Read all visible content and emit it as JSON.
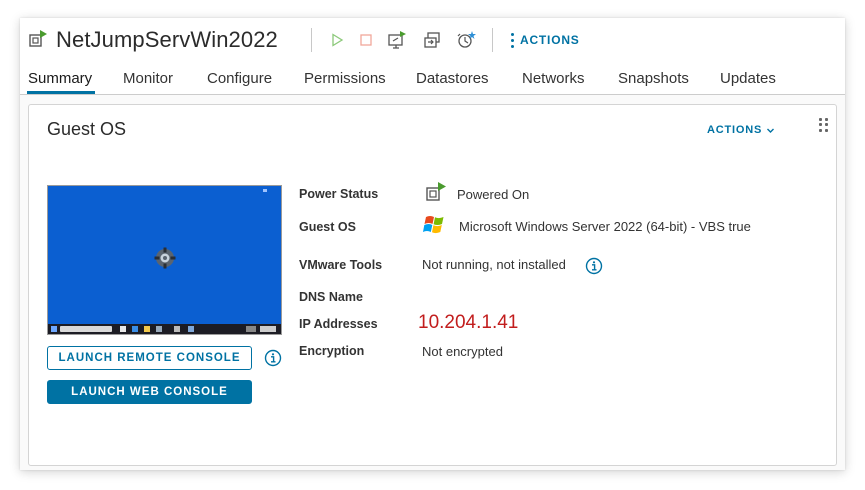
{
  "header": {
    "vm_name": "NetJumpServWin2022",
    "actions_label": "ACTIONS",
    "toolbar_icons": [
      "power-on-icon",
      "power-off-icon",
      "launch-console-icon",
      "migrate-icon",
      "snapshot-icon"
    ]
  },
  "tabs": [
    {
      "label": "Summary",
      "active": true
    },
    {
      "label": "Monitor",
      "active": false
    },
    {
      "label": "Configure",
      "active": false
    },
    {
      "label": "Permissions",
      "active": false
    },
    {
      "label": "Datastores",
      "active": false
    },
    {
      "label": "Networks",
      "active": false
    },
    {
      "label": "Snapshots",
      "active": false
    },
    {
      "label": "Updates",
      "active": false
    }
  ],
  "card": {
    "title": "Guest OS",
    "actions_label": "ACTIONS",
    "launch_remote_console": "LAUNCH REMOTE CONSOLE",
    "launch_web_console": "LAUNCH WEB CONSOLE",
    "properties": {
      "power_status": {
        "label": "Power Status",
        "value": "Powered On"
      },
      "guest_os": {
        "label": "Guest OS",
        "value": "Microsoft Windows Server 2022 (64-bit) - VBS true"
      },
      "vmware_tools": {
        "label": "VMware Tools",
        "value": "Not running, not installed"
      },
      "dns_name": {
        "label": "DNS Name",
        "value": ""
      },
      "ip_addresses": {
        "label": "IP Addresses",
        "value": "10.204.1.41"
      },
      "encryption": {
        "label": "Encryption",
        "value": "Not encrypted"
      }
    }
  },
  "colors": {
    "accent": "#0072a3",
    "ip_text": "#c21d1d",
    "powered_on": "#4a9b2e",
    "console_bg": "#0b5fd1"
  }
}
